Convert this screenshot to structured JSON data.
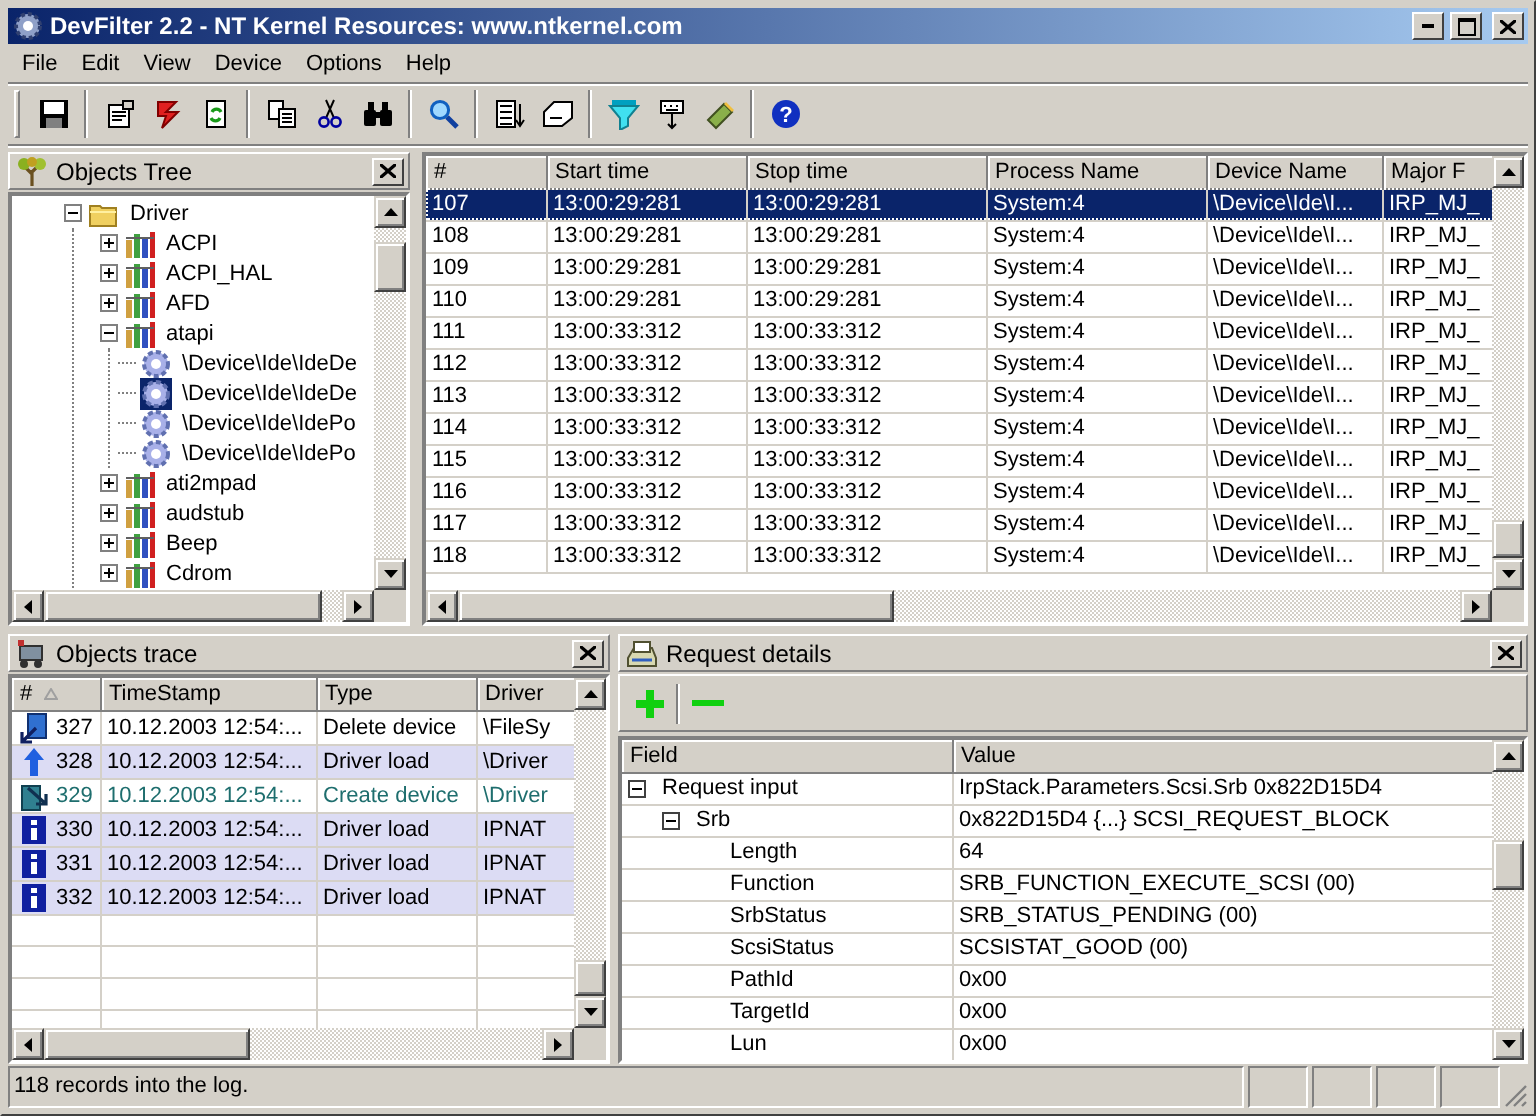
{
  "window": {
    "title": "DevFilter 2.2 - NT Kernel Resources: www.ntkernel.com"
  },
  "menu": [
    {
      "label": "File"
    },
    {
      "label": "Edit"
    },
    {
      "label": "View"
    },
    {
      "label": "Device"
    },
    {
      "label": "Options"
    },
    {
      "label": "Help"
    }
  ],
  "toolbar": [
    {
      "kind": "save"
    },
    {
      "kind": "separator"
    },
    {
      "kind": "properties"
    },
    {
      "kind": "bolt"
    },
    {
      "kind": "refresh"
    },
    {
      "kind": "separator"
    },
    {
      "kind": "copy"
    },
    {
      "kind": "cut"
    },
    {
      "kind": "find"
    },
    {
      "kind": "separator"
    },
    {
      "kind": "search"
    },
    {
      "kind": "separator"
    },
    {
      "kind": "list"
    },
    {
      "kind": "eraser"
    },
    {
      "kind": "separator"
    },
    {
      "kind": "funnel"
    },
    {
      "kind": "keyboard"
    },
    {
      "kind": "brush"
    },
    {
      "kind": "separator"
    },
    {
      "kind": "help",
      "glyph": "?"
    }
  ],
  "objects_tree": {
    "title": "Objects Tree",
    "items": [
      {
        "label": "Driver",
        "kind": "folder",
        "expanded": true,
        "selected": false,
        "children": [
          {
            "label": "ACPI",
            "kind": "driver",
            "expanded": false,
            "selected": false
          },
          {
            "label": "ACPI_HAL",
            "kind": "driver",
            "expanded": false,
            "selected": false
          },
          {
            "label": "AFD",
            "kind": "driver",
            "expanded": false,
            "selected": false
          },
          {
            "label": "atapi",
            "kind": "driver",
            "expanded": true,
            "selected": false,
            "children": [
              {
                "label": "\\Device\\Ide\\IdeDe",
                "kind": "device",
                "selected": false
              },
              {
                "label": "\\Device\\Ide\\IdeDe",
                "kind": "device",
                "selected": true
              },
              {
                "label": "\\Device\\Ide\\IdePo",
                "kind": "device",
                "selected": false
              },
              {
                "label": "\\Device\\Ide\\IdePo",
                "kind": "device",
                "selected": false
              }
            ]
          },
          {
            "label": "ati2mpad",
            "kind": "driver",
            "expanded": false,
            "selected": false
          },
          {
            "label": "audstub",
            "kind": "driver",
            "expanded": false,
            "selected": false
          },
          {
            "label": "Beep",
            "kind": "driver",
            "expanded": false,
            "selected": false
          },
          {
            "label": "Cdrom",
            "kind": "driver",
            "expanded": false,
            "selected": false
          }
        ]
      }
    ]
  },
  "requests": {
    "columns": [
      "#",
      "Start time",
      "Stop time",
      "Process Name",
      "Device Name",
      "Major F"
    ],
    "rows": [
      {
        "selected": true,
        "cells": [
          "107",
          "13:00:29:281",
          "13:00:29:281",
          "System:4",
          "\\Device\\Ide\\I...",
          "IRP_MJ_"
        ]
      },
      {
        "selected": false,
        "cells": [
          "108",
          "13:00:29:281",
          "13:00:29:281",
          "System:4",
          "\\Device\\Ide\\I...",
          "IRP_MJ_"
        ]
      },
      {
        "selected": false,
        "cells": [
          "109",
          "13:00:29:281",
          "13:00:29:281",
          "System:4",
          "\\Device\\Ide\\I...",
          "IRP_MJ_"
        ]
      },
      {
        "selected": false,
        "cells": [
          "110",
          "13:00:29:281",
          "13:00:29:281",
          "System:4",
          "\\Device\\Ide\\I...",
          "IRP_MJ_"
        ]
      },
      {
        "selected": false,
        "cells": [
          "111",
          "13:00:33:312",
          "13:00:33:312",
          "System:4",
          "\\Device\\Ide\\I...",
          "IRP_MJ_"
        ]
      },
      {
        "selected": false,
        "cells": [
          "112",
          "13:00:33:312",
          "13:00:33:312",
          "System:4",
          "\\Device\\Ide\\I...",
          "IRP_MJ_"
        ]
      },
      {
        "selected": false,
        "cells": [
          "113",
          "13:00:33:312",
          "13:00:33:312",
          "System:4",
          "\\Device\\Ide\\I...",
          "IRP_MJ_"
        ]
      },
      {
        "selected": false,
        "cells": [
          "114",
          "13:00:33:312",
          "13:00:33:312",
          "System:4",
          "\\Device\\Ide\\I...",
          "IRP_MJ_"
        ]
      },
      {
        "selected": false,
        "cells": [
          "115",
          "13:00:33:312",
          "13:00:33:312",
          "System:4",
          "\\Device\\Ide\\I...",
          "IRP_MJ_"
        ]
      },
      {
        "selected": false,
        "cells": [
          "116",
          "13:00:33:312",
          "13:00:33:312",
          "System:4",
          "\\Device\\Ide\\I...",
          "IRP_MJ_"
        ]
      },
      {
        "selected": false,
        "cells": [
          "117",
          "13:00:33:312",
          "13:00:33:312",
          "System:4",
          "\\Device\\Ide\\I...",
          "IRP_MJ_"
        ]
      },
      {
        "selected": false,
        "cells": [
          "118",
          "13:00:33:312",
          "13:00:33:312",
          "System:4",
          "\\Device\\Ide\\I...",
          "IRP_MJ_"
        ]
      }
    ]
  },
  "objects_trace": {
    "title": "Objects trace",
    "columns": [
      {
        "label": "#",
        "sorted": true
      },
      {
        "label": "TimeStamp"
      },
      {
        "label": "Type"
      },
      {
        "label": "Driver"
      }
    ],
    "rows": [
      {
        "kind": "delete",
        "highlighted": false,
        "color": "#000000",
        "cells": [
          "327",
          "10.12.2003 12:54:...",
          "Delete device",
          "\\FileSy"
        ]
      },
      {
        "kind": "load",
        "highlighted": true,
        "color": "#000000",
        "cells": [
          "328",
          "10.12.2003 12:54:...",
          "Driver load",
          "\\Driver"
        ]
      },
      {
        "kind": "create",
        "highlighted": false,
        "color": "#1e6e6e",
        "cells": [
          "329",
          "10.12.2003 12:54:...",
          "Create device",
          "\\Driver"
        ]
      },
      {
        "kind": "info",
        "highlighted": true,
        "color": "#000000",
        "cells": [
          "330",
          "10.12.2003 12:54:...",
          "Driver load",
          "IPNAT"
        ]
      },
      {
        "kind": "info",
        "highlighted": true,
        "color": "#000000",
        "cells": [
          "331",
          "10.12.2003 12:54:...",
          "Driver load",
          "IPNAT"
        ]
      },
      {
        "kind": "info",
        "highlighted": true,
        "color": "#000000",
        "cells": [
          "332",
          "10.12.2003 12:54:...",
          "Driver load",
          "IPNAT"
        ]
      }
    ]
  },
  "request_details": {
    "title": "Request details",
    "toolbar": [
      {
        "kind": "expand"
      },
      {
        "kind": "collapse"
      }
    ],
    "columns": [
      "Field",
      "Value"
    ],
    "rows": [
      {
        "field": "Request input",
        "value": "IrpStack.Parameters.Scsi.Srb 0x822D15D4",
        "expanded": true,
        "children": [
          {
            "field": "Srb",
            "value": "0x822D15D4 {...} SCSI_REQUEST_BLOCK",
            "expanded": true,
            "children": [
              {
                "field": "Length",
                "value": "64"
              },
              {
                "field": "Function",
                "value": "SRB_FUNCTION_EXECUTE_SCSI (00)"
              },
              {
                "field": "SrbStatus",
                "value": "SRB_STATUS_PENDING (00)"
              },
              {
                "field": "ScsiStatus",
                "value": "SCSISTAT_GOOD (00)"
              },
              {
                "field": "PathId",
                "value": "0x00"
              },
              {
                "field": "TargetId",
                "value": "0x00"
              },
              {
                "field": "Lun",
                "value": "0x00"
              }
            ]
          }
        ]
      }
    ]
  },
  "status_bar": {
    "text": "118 records into the log."
  }
}
